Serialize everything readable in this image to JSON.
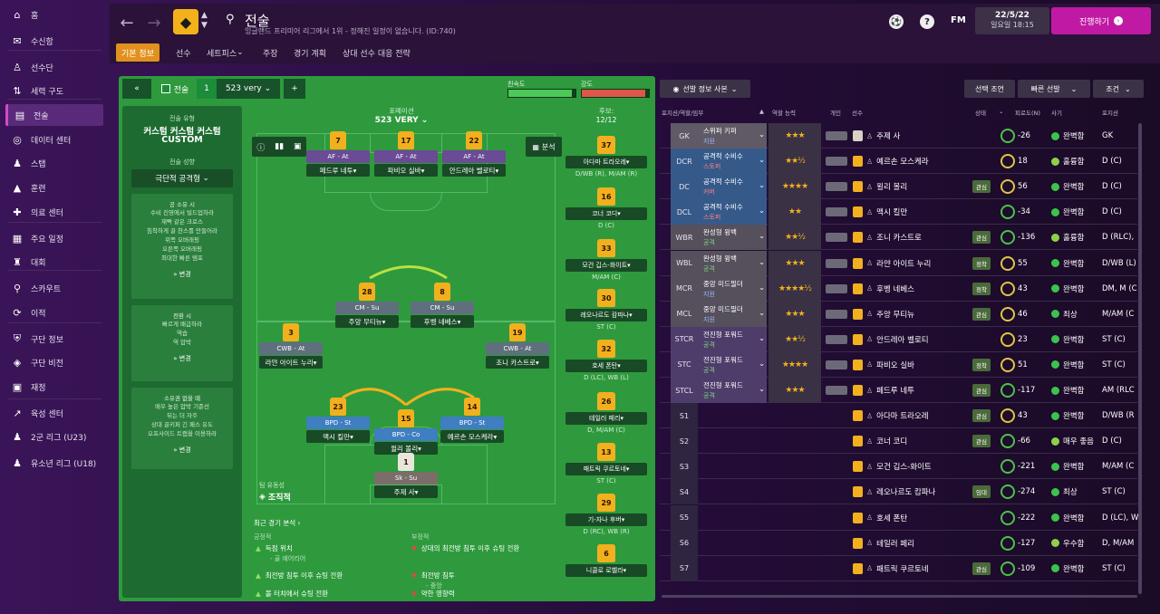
{
  "sidebar": {
    "items": [
      {
        "label": "홈",
        "icon": "home-icon"
      },
      {
        "label": "수신함",
        "icon": "inbox-icon"
      },
      {
        "label": "선수단",
        "icon": "squad-icon"
      },
      {
        "label": "세력 구도",
        "icon": "dynamics-icon"
      },
      {
        "label": "전술",
        "icon": "tactics-icon"
      },
      {
        "label": "데이터 센터",
        "icon": "data-icon"
      },
      {
        "label": "스탭",
        "icon": "staff-icon"
      },
      {
        "label": "훈련",
        "icon": "training-icon"
      },
      {
        "label": "의료 센터",
        "icon": "medical-icon"
      },
      {
        "label": "주요 일정",
        "icon": "calendar-icon"
      },
      {
        "label": "대회",
        "icon": "trophy-icon"
      },
      {
        "label": "스카우트",
        "icon": "scout-icon"
      },
      {
        "label": "이적",
        "icon": "transfer-icon"
      },
      {
        "label": "구단 정보",
        "icon": "club-icon"
      },
      {
        "label": "구단 비전",
        "icon": "vision-icon"
      },
      {
        "label": "재정",
        "icon": "finance-icon"
      },
      {
        "label": "육성 센터",
        "icon": "development-icon"
      },
      {
        "label": "2군 리그 (U23)",
        "icon": "reserve-icon"
      },
      {
        "label": "유소년 리그 (U18)",
        "icon": "youth-icon"
      }
    ]
  },
  "header": {
    "title": "전술",
    "subtitle": "잉글랜드 프리미어 리그에서 1위 - 정해진 일정이 없습니다. (ID:740)",
    "tabs": [
      "기본 정보",
      "선수",
      "세트피스",
      "주장",
      "경기 계획",
      "상대 선수 대응 전략"
    ],
    "fm_label": "FM",
    "date": "22/5/22",
    "datetime": "일요일 18:15",
    "proceed_label": "진행하기"
  },
  "tactic_bar": {
    "back": "«",
    "tactic_label": "전술",
    "slot": "1",
    "name": "523 very",
    "add": "+",
    "familiarity_label": "친숙도",
    "familiarity_value": 0.95,
    "intensity_label": "강도",
    "intensity_value": 0.95
  },
  "tactic_style": {
    "type_label": "전술 유형",
    "type_name": "커스텀 커스텀 커스텀",
    "type_tag": "CUSTOM",
    "mentality_label": "전술 성향",
    "mentality": "극단적 공격형",
    "in_possession": {
      "title": "공 소유 시",
      "lines": [
        "수비 진영에서 빌드업하라",
        "재빡 같은 크로스",
        "침착하게 골 찬스를 만들어라",
        "위쪽 오버래핑",
        "오른쪽 오버래핑",
        "최대한 빠른 템포"
      ],
      "change": "변경"
    },
    "transition": {
      "title": "전환 시",
      "lines": [
        "빠르게 배급하라",
        "역습",
        "역 압박"
      ],
      "change": "변경"
    },
    "out_possession": {
      "title": "소유권 없을 때",
      "lines": [
        "매우 높은 압박 기준선",
        "뒤는 더 자주",
        "상대 골키퍼 긴 패스 유도",
        "오프사이드 트랩을 이용하라"
      ],
      "change": "변경"
    }
  },
  "pitch": {
    "formation_label": "포메이션",
    "formation": "523 VERY",
    "subs_label": "후보:",
    "subs_count": "12/12",
    "analysis_label": "분석",
    "fluidity_label": "팀 유동성",
    "fluidity": "조직적",
    "players": [
      {
        "num": "7",
        "role": "AF - At",
        "name": "페드루 네투",
        "cls": "att"
      },
      {
        "num": "17",
        "role": "AF - At",
        "name": "파비오 실바",
        "cls": "att"
      },
      {
        "num": "22",
        "role": "AF - At",
        "name": "안드레아 벨로티",
        "cls": "att"
      },
      {
        "num": "28",
        "role": "CM - Su",
        "name": "주앙 무티뉴",
        "cls": "mid"
      },
      {
        "num": "8",
        "role": "CM - Su",
        "name": "후벵 네베스",
        "cls": "mid"
      },
      {
        "num": "3",
        "role": "CWB - At",
        "name": "라얀 아이트 누리",
        "cls": "mid"
      },
      {
        "num": "19",
        "role": "CWB - At",
        "name": "조니 카스트로",
        "cls": "mid"
      },
      {
        "num": "23",
        "role": "BPD - St",
        "name": "맥시 킬만",
        "cls": "def"
      },
      {
        "num": "15",
        "role": "BPD - Co",
        "name": "윌리 볼리",
        "cls": "def"
      },
      {
        "num": "14",
        "role": "BPD - St",
        "name": "예르손 모스케라",
        "cls": "def"
      },
      {
        "num": "1",
        "role": "Sk - Su",
        "name": "주제 사",
        "cls": "gkr"
      }
    ]
  },
  "subs": [
    {
      "num": "37",
      "name": "아다마 트라오레",
      "pos": "D/WB (R), M/AM (R)"
    },
    {
      "num": "16",
      "name": "코너 코디",
      "pos": "D (C)"
    },
    {
      "num": "33",
      "name": "모건 깁스-화이트",
      "pos": "M/AM (C)"
    },
    {
      "num": "30",
      "name": "레오나르도 캄파나",
      "pos": "ST (C)"
    },
    {
      "num": "32",
      "name": "호세 폰탄",
      "pos": "D (LC), WB (L)"
    },
    {
      "num": "26",
      "name": "테일러 페리",
      "pos": "D, M/AM (C)"
    },
    {
      "num": "13",
      "name": "패트릭 쿠르토네",
      "pos": "ST (C)"
    },
    {
      "num": "29",
      "name": "기-자나 후버",
      "pos": "D (RC), WB (R)"
    },
    {
      "num": "6",
      "name": "니콜로 로벨라",
      "pos": ""
    }
  ],
  "analysis": {
    "title": "최근 경기 분석",
    "positive_label": "긍정적",
    "negative_label": "부정적",
    "positives": [
      {
        "title": "득점 위치",
        "sub": "- 골 에어리어"
      },
      {
        "title": "최전방 침투 이후 슈팅 전환",
        "sub": ""
      },
      {
        "title": "볼 터치에서 슈팅 전환",
        "sub": ""
      }
    ],
    "negatives": [
      {
        "title": "상대의 최전방 침투 이후 슈팅 전환",
        "sub": ""
      },
      {
        "title": "최전방 침투",
        "sub": "- 중앙"
      },
      {
        "title": "약한 영향력",
        "sub": ""
      }
    ]
  },
  "right": {
    "view_label": "선발 정보 사본",
    "select_label": "선택 조언",
    "quick_label": "빠른 선발",
    "filter_label": "조건",
    "columns": [
      "포지션/역할/임무",
      "역할 능력",
      "개인",
      "선수",
      "상태",
      "피로도(N)",
      "사기",
      "포지션"
    ],
    "rows": [
      {
        "pos": "GK",
        "role": "스위퍼 키퍼",
        "duty": "지원",
        "stars": "★★★",
        "name": "주제 사",
        "fit": "-26",
        "cond": "완벽함",
        "posn": "GK",
        "tag": "",
        "bg": "#5f5a66",
        "dutyc": "#9fb7ff"
      },
      {
        "pos": "DCR",
        "role": "공격적 수비수",
        "duty": "스토퍼",
        "stars": "★★½",
        "name": "예르손 모스케라",
        "fit": "18",
        "cond": "훌륭함",
        "posn": "D (C)",
        "tag": "",
        "bg": "#355a8a",
        "dutyc": "#ff7d7d"
      },
      {
        "pos": "DC",
        "role": "공격적 수비수",
        "duty": "커버",
        "stars": "★★★★",
        "name": "윌리 볼리",
        "fit": "56",
        "cond": "완벽함",
        "posn": "D (C)",
        "tag": "관심",
        "bg": "#355a8a",
        "dutyc": "#ff7d7d"
      },
      {
        "pos": "DCL",
        "role": "공격적 수비수",
        "duty": "스토퍼",
        "stars": "★★",
        "name": "맥시 킬만",
        "fit": "-34",
        "cond": "완벽함",
        "posn": "D (C)",
        "tag": "",
        "bg": "#355a8a",
        "dutyc": "#ff7d7d"
      },
      {
        "pos": "WBR",
        "role": "완성형 윙백",
        "duty": "공격",
        "stars": "★★½",
        "name": "조니 카스트로",
        "fit": "-136",
        "cond": "훌륭함",
        "posn": "D (RLC),",
        "tag": "관심",
        "bg": "#55505c",
        "dutyc": "#7dd57d"
      },
      {
        "pos": "WBL",
        "role": "완성형 윙백",
        "duty": "공격",
        "stars": "★★★",
        "name": "라얀 아이트 누리",
        "fit": "55",
        "cond": "완벽함",
        "posn": "D/WB (L)",
        "tag": "정착",
        "bg": "#55505c",
        "dutyc": "#7dd57d"
      },
      {
        "pos": "MCR",
        "role": "중앙 미드필더",
        "duty": "지원",
        "stars": "★★★★½",
        "name": "후벵 네베스",
        "fit": "43",
        "cond": "완벽함",
        "posn": "DM, M (C",
        "tag": "정착",
        "bg": "#55505c",
        "dutyc": "#9fb7ff"
      },
      {
        "pos": "MCL",
        "role": "중앙 미드필더",
        "duty": "지원",
        "stars": "★★★",
        "name": "주앙 무티뉴",
        "fit": "46",
        "cond": "최상",
        "posn": "M/AM (C",
        "tag": "관심",
        "bg": "#55505c",
        "dutyc": "#9fb7ff"
      },
      {
        "pos": "STCR",
        "role": "전진형 포워드",
        "duty": "공격",
        "stars": "★★½",
        "name": "안드레아 벨로티",
        "fit": "23",
        "cond": "완벽함",
        "posn": "ST (C)",
        "tag": "",
        "bg": "#4e3d6a",
        "dutyc": "#7dd57d"
      },
      {
        "pos": "STC",
        "role": "전진형 포워드",
        "duty": "공격",
        "stars": "★★★★",
        "name": "파비오 실바",
        "fit": "51",
        "cond": "완벽함",
        "posn": "ST (C)",
        "tag": "정착",
        "bg": "#4e3d6a",
        "dutyc": "#7dd57d"
      },
      {
        "pos": "STCL",
        "role": "전진형 포워드",
        "duty": "공격",
        "stars": "★★★",
        "name": "페드루 네투",
        "fit": "-117",
        "cond": "완벽함",
        "posn": "AM (RLC",
        "tag": "관심",
        "bg": "#4e3d6a",
        "dutyc": "#7dd57d"
      },
      {
        "pos": "S1",
        "role": "",
        "duty": "",
        "stars": "",
        "name": "아다마 트라오레",
        "fit": "43",
        "cond": "완벽함",
        "posn": "D/WB (R",
        "tag": "관심",
        "bg": "",
        "dutyc": ""
      },
      {
        "pos": "S2",
        "role": "",
        "duty": "",
        "stars": "",
        "name": "코너 코디",
        "fit": "-66",
        "cond": "매우 좋음",
        "posn": "D (C)",
        "tag": "관심",
        "bg": "",
        "dutyc": ""
      },
      {
        "pos": "S3",
        "role": "",
        "duty": "",
        "stars": "",
        "name": "모건 깁스-화이트",
        "fit": "-221",
        "cond": "완벽함",
        "posn": "M/AM (C",
        "tag": "",
        "bg": "",
        "dutyc": ""
      },
      {
        "pos": "S4",
        "role": "",
        "duty": "",
        "stars": "",
        "name": "레오나르도 캄파나",
        "fit": "-274",
        "cond": "최상",
        "posn": "ST (C)",
        "tag": "임대",
        "bg": "",
        "dutyc": ""
      },
      {
        "pos": "S5",
        "role": "",
        "duty": "",
        "stars": "",
        "name": "호세 폰탄",
        "fit": "-222",
        "cond": "완벽함",
        "posn": "D (LC), W",
        "tag": "",
        "bg": "",
        "dutyc": ""
      },
      {
        "pos": "S6",
        "role": "",
        "duty": "",
        "stars": "",
        "name": "테일러 페리",
        "fit": "-127",
        "cond": "우수함",
        "posn": "D, M/AM",
        "tag": "",
        "bg": "",
        "dutyc": ""
      },
      {
        "pos": "S7",
        "role": "",
        "duty": "",
        "stars": "",
        "name": "패트릭 쿠르토네",
        "fit": "-109",
        "cond": "완벽함",
        "posn": "ST (C)",
        "tag": "관심",
        "bg": "",
        "dutyc": ""
      }
    ]
  }
}
